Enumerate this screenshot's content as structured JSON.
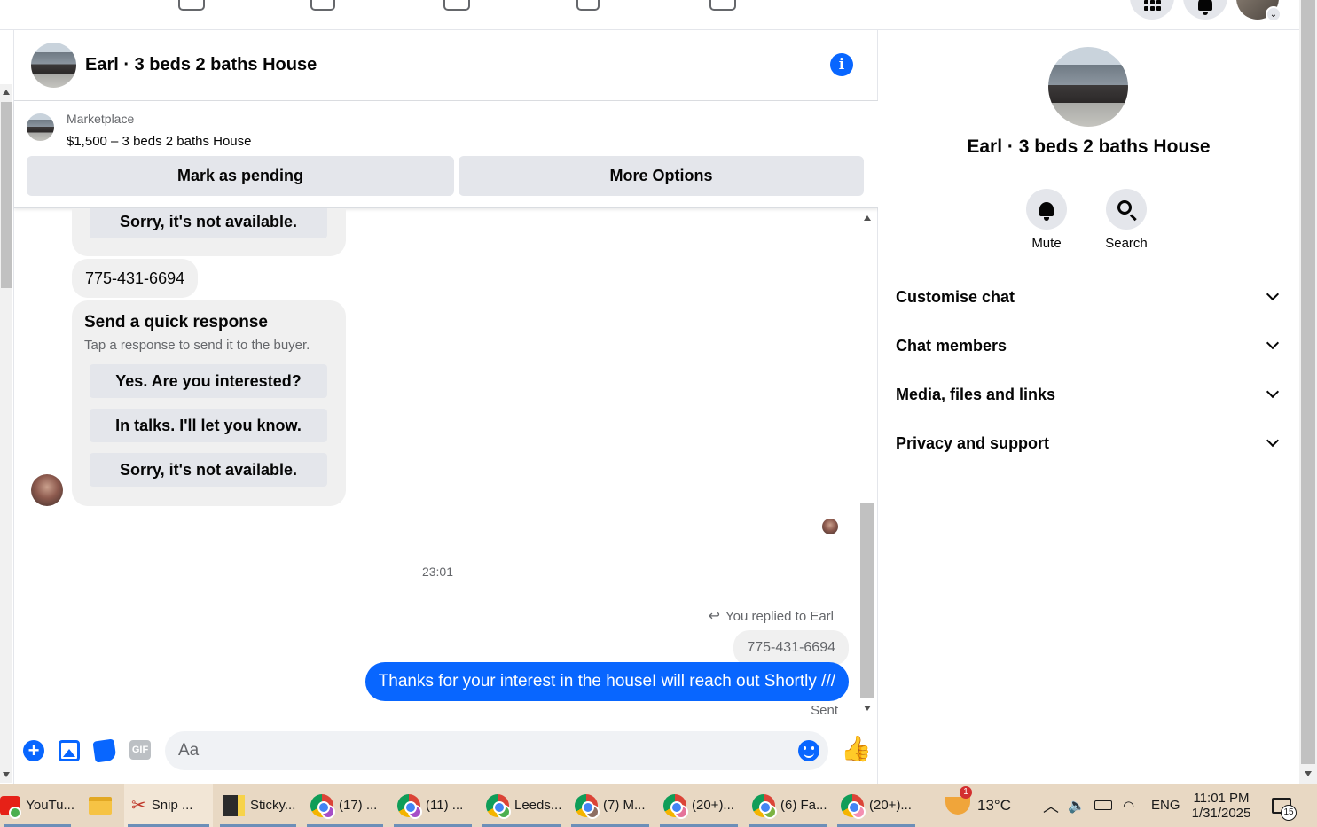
{
  "chat": {
    "title": "Earl · 3 beds 2 baths House",
    "listing": {
      "source": "Marketplace",
      "title": "$1,500 – 3 beds 2 baths House",
      "mark_pending_label": "Mark as pending",
      "more_options_label": "More Options"
    },
    "messages": {
      "top_quick_reply": "Sorry, it's not available.",
      "phone_message": "775-431-6694",
      "quick_response": {
        "title": "Send a quick response",
        "subtitle": "Tap a response to send it to the buyer.",
        "options": [
          "Yes. Are you interested?",
          "In talks. I'll let you know.",
          "Sorry, it's not available."
        ]
      },
      "timestamp": "23:01",
      "replied_label": "You replied to Earl",
      "replied_quote": "775-431-6694",
      "sent_message": "Thanks for your interest in the houseI will reach out Shortly ///",
      "sent_status": "Sent"
    },
    "composer": {
      "placeholder": "Aa",
      "gif_label": "GIF"
    }
  },
  "info_panel": {
    "name": "Earl · 3 beds 2 baths House",
    "actions": [
      "Mute",
      "Search"
    ],
    "sections": [
      "Customise chat",
      "Chat members",
      "Media, files and links",
      "Privacy and support"
    ]
  },
  "taskbar": {
    "apps": [
      "YouTu...",
      "Snip ...",
      "Sticky...",
      "(17) ...",
      "(11) ...",
      "Leeds...",
      "(7) M...",
      "(20+)...",
      "(6) Fa...",
      "(20+)..."
    ],
    "weather": "13°C",
    "weather_badge": "1",
    "language": "ENG",
    "time": "11:01 PM",
    "date": "1/31/2025",
    "notifications": "15"
  },
  "colors": {
    "accent": "#0866ff",
    "bubble_gray": "#f0f0f0",
    "button_gray": "#e4e6eb",
    "muted_text": "#65676b",
    "taskbar": "#e8d8c3"
  }
}
